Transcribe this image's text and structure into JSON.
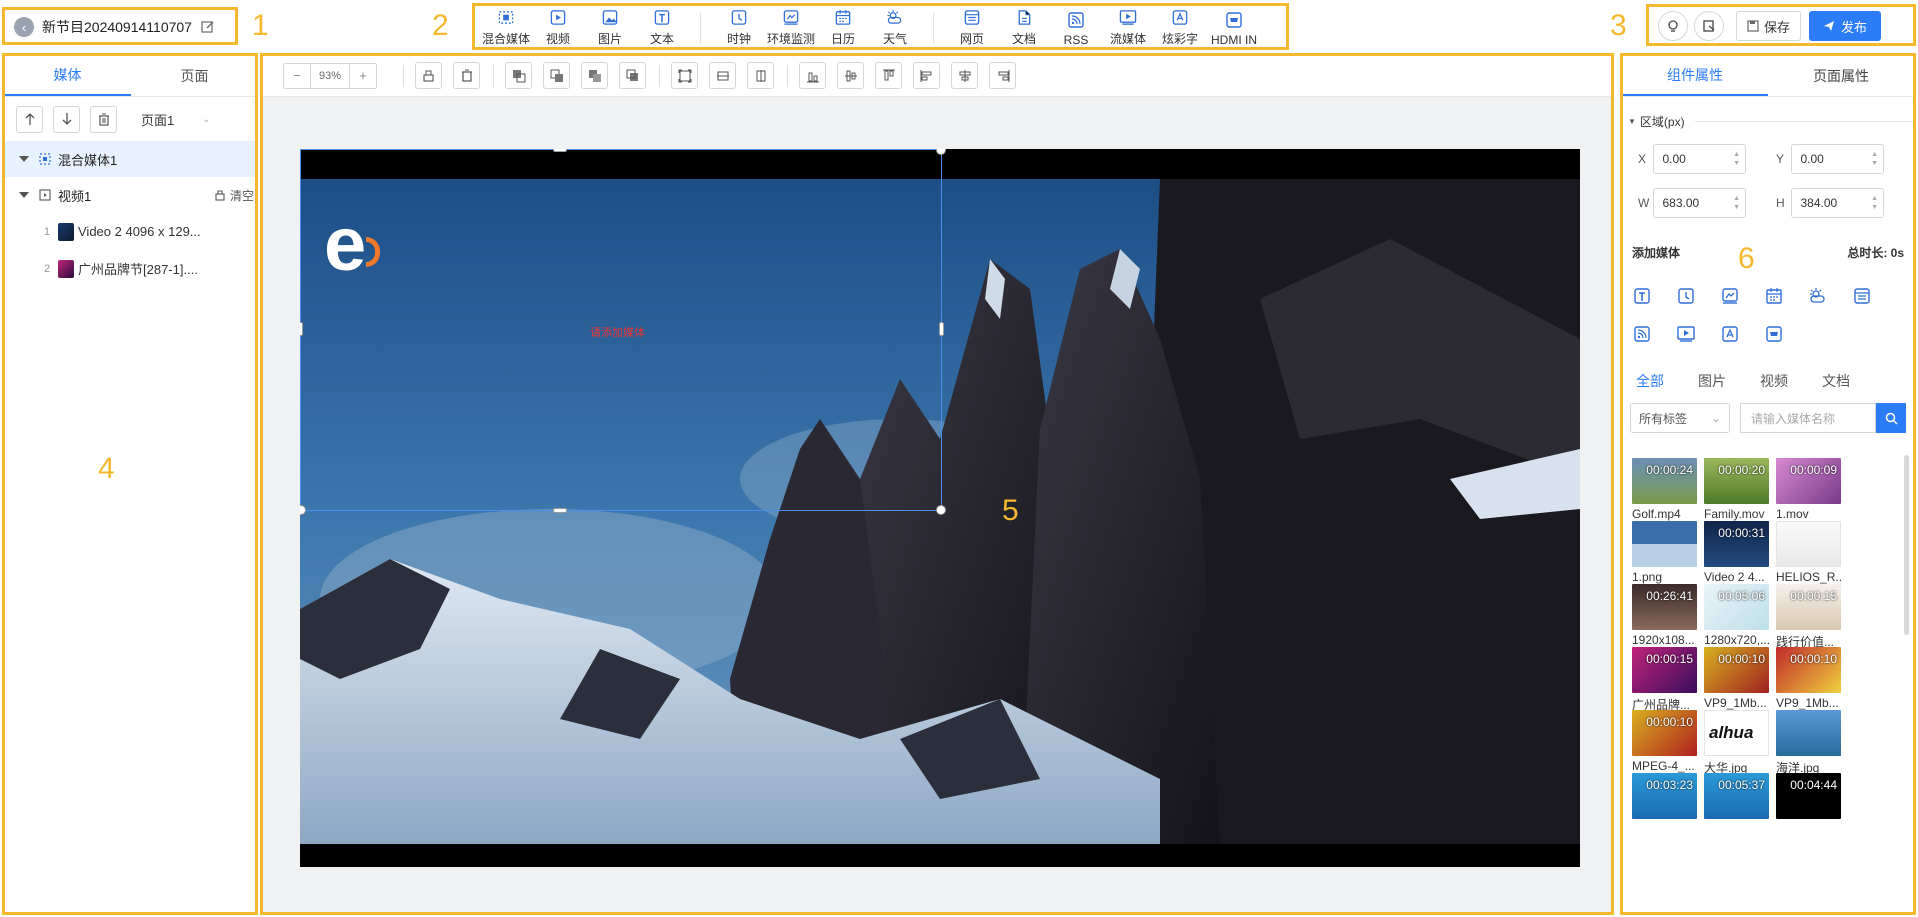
{
  "header": {
    "title": "新节目20240914110707",
    "toolbar": [
      {
        "label": "混合媒体",
        "icon": "mixed-media-icon"
      },
      {
        "label": "视频",
        "icon": "video-icon"
      },
      {
        "label": "图片",
        "icon": "image-icon"
      },
      {
        "label": "文本",
        "icon": "text-icon"
      },
      {
        "label": "时钟",
        "icon": "clock-icon"
      },
      {
        "label": "环境监测",
        "icon": "env-monitor-icon"
      },
      {
        "label": "日历",
        "icon": "calendar-icon"
      },
      {
        "label": "天气",
        "icon": "weather-icon"
      },
      {
        "label": "网页",
        "icon": "webpage-icon"
      },
      {
        "label": "文档",
        "icon": "document-icon"
      },
      {
        "label": "RSS",
        "icon": "rss-icon"
      },
      {
        "label": "流媒体",
        "icon": "stream-icon"
      },
      {
        "label": "炫彩字",
        "icon": "color-text-icon"
      },
      {
        "label": "HDMI IN",
        "icon": "hdmi-icon"
      }
    ],
    "save_label": "保存",
    "publish_label": "发布"
  },
  "annotations": [
    "1",
    "2",
    "3",
    "4",
    "5",
    "6"
  ],
  "left": {
    "tabs": [
      "媒体",
      "页面"
    ],
    "page_select": "页面1",
    "tree": {
      "mixed": "混合媒体1",
      "video": "视频1",
      "clear": "清空",
      "items": [
        {
          "idx": "1",
          "name": "Video 2 4096 x 129..."
        },
        {
          "idx": "2",
          "name": "广州品牌节[287-1]...."
        }
      ]
    }
  },
  "canvas": {
    "zoom": "93%",
    "minus": "−",
    "plus": "+",
    "caption": "请添加媒体",
    "logo_letter": "e"
  },
  "right": {
    "tabs": [
      "组件属性",
      "页面属性"
    ],
    "area_title": "区域(px)",
    "x_label": "X",
    "x": "0.00",
    "y_label": "Y",
    "y": "0.00",
    "w_label": "W",
    "w": "683.00",
    "h_label": "H",
    "h": "384.00",
    "add_media": "添加媒体",
    "duration": "总时长:  0s",
    "media_tabs": [
      "全部",
      "图片",
      "视频",
      "文档"
    ],
    "tag_select": "所有标签",
    "search_placeholder": "请输入媒体名称",
    "media": [
      {
        "name": "Golf.mp4",
        "dur": "00:00:24"
      },
      {
        "name": "Family.mov",
        "dur": "00:00:20"
      },
      {
        "name": "1.mov",
        "dur": "00:00:09"
      },
      {
        "name": "1.png",
        "dur": ""
      },
      {
        "name": "Video 2 4...",
        "dur": "00:00:31"
      },
      {
        "name": "HELIOS_R...",
        "dur": ""
      },
      {
        "name": "1920x108...",
        "dur": "00:26:41"
      },
      {
        "name": "1280x720,...",
        "dur": "00:05:06"
      },
      {
        "name": "践行价值...",
        "dur": "00:00:15"
      },
      {
        "name": "广州品牌...",
        "dur": "00:00:15"
      },
      {
        "name": "VP9_1Mb...",
        "dur": "00:00:10"
      },
      {
        "name": "VP9_1Mb...",
        "dur": "00:00:10"
      },
      {
        "name": "MPEG-4_...",
        "dur": "00:00:10"
      },
      {
        "name": "大华.jpg",
        "dur": "",
        "logo": "alhua"
      },
      {
        "name": "海洋.jpg",
        "dur": ""
      },
      {
        "name": "",
        "dur": "00:03:23"
      },
      {
        "name": "",
        "dur": "00:05:37"
      },
      {
        "name": "",
        "dur": "00:04:44"
      }
    ]
  },
  "colors": {
    "accent": "#2b7cf6",
    "highlight": "#f5b82e"
  }
}
